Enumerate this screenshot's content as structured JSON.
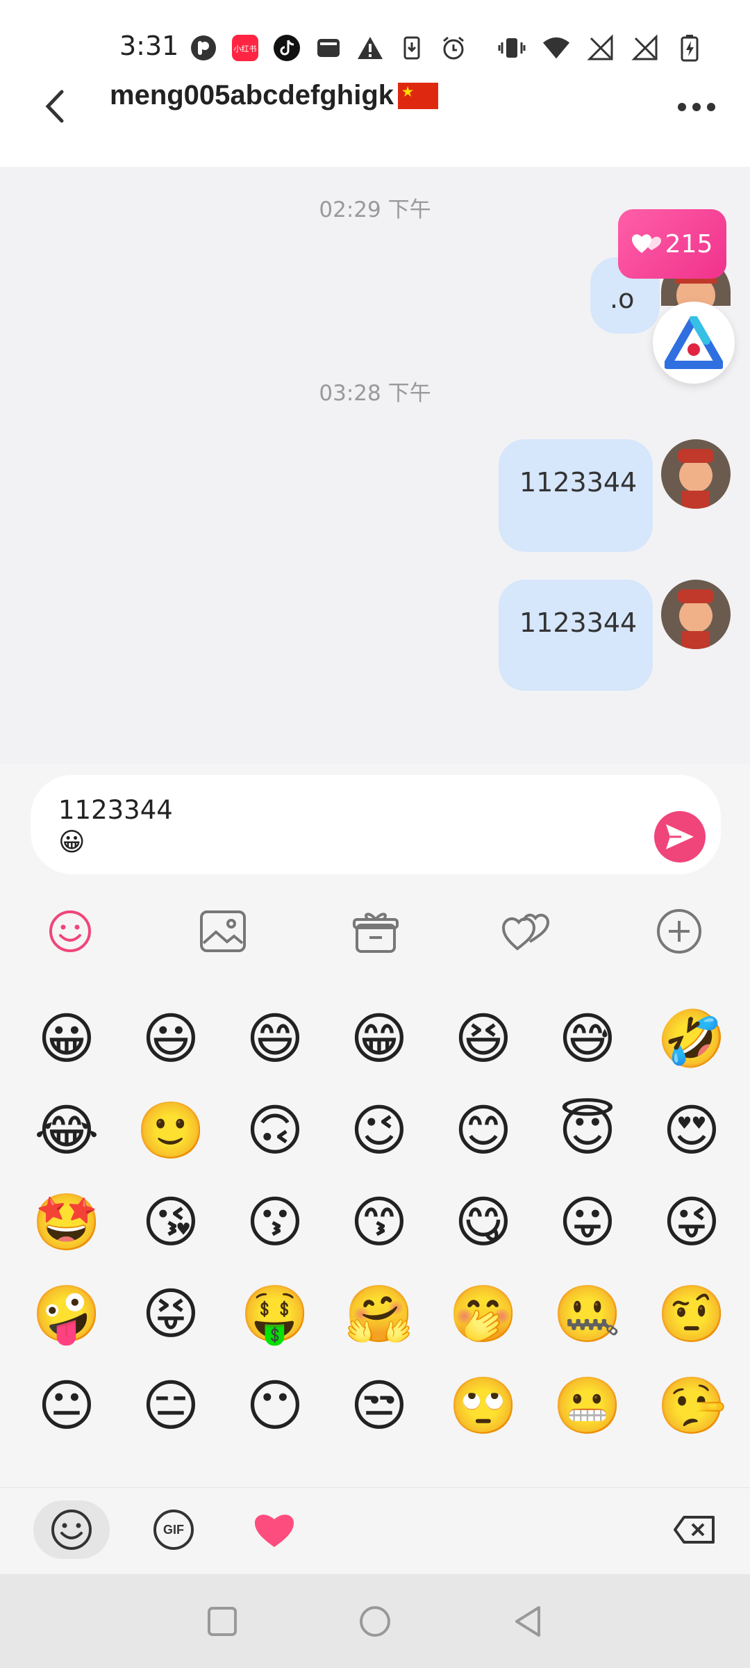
{
  "status_bar": {
    "time": "3:31",
    "left_icons": [
      "p-app-icon",
      "xiaohongshu-icon",
      "tiktok-icon",
      "notification-icon",
      "warning-icon",
      "download-icon",
      "alarm-icon"
    ],
    "right_icons": [
      "vibrate-icon",
      "wifi-icon",
      "no-signal-icon",
      "no-signal-icon",
      "battery-charging-icon"
    ]
  },
  "header": {
    "title": "meng005abcdefghigk",
    "has_flag": true
  },
  "chat": {
    "timestamps": [
      "02:29 下午",
      "03:28 下午"
    ],
    "likes_badge": "215",
    "messages": [
      {
        "text": ".o",
        "from": "me"
      },
      {
        "text": "1123344",
        "from": "me"
      },
      {
        "text": "1123344",
        "from": "me"
      }
    ]
  },
  "input": {
    "text_line1": "1123344",
    "text_line2": "😀"
  },
  "toolbar": {
    "items": [
      "emoji-icon",
      "image-icon",
      "gift-icon",
      "hearts-icon",
      "plus-icon"
    ],
    "active_color": "#f0457a"
  },
  "emoji_grid": {
    "rows": [
      [
        "😀",
        "😃",
        "😄",
        "😁",
        "😆",
        "😅",
        "🤣"
      ],
      [
        "😂",
        "🙂",
        "🙃",
        "😉",
        "😊",
        "😇",
        "😍"
      ],
      [
        "🤩",
        "😘",
        "😗",
        "😙",
        "😋",
        "😛",
        "😜"
      ],
      [
        "🤪",
        "😝",
        "🤑",
        "🤗",
        "🤭",
        "🤐",
        "🤨"
      ],
      [
        "😐",
        "😑",
        "😶",
        "😒",
        "🙄",
        "😬",
        "🤥"
      ]
    ]
  },
  "emoji_bar": {
    "gif_label": "GIF"
  },
  "colors": {
    "accent": "#f0457a",
    "bubble": "#d6e6fb",
    "badge": "#f0328c"
  }
}
